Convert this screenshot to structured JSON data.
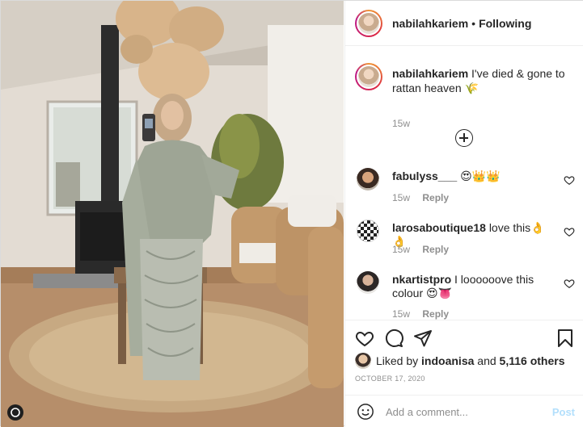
{
  "header": {
    "username": "nabilahkariem",
    "separator": "•",
    "follow_status": "Following"
  },
  "caption": {
    "username": "nabilahkariem",
    "text": "I've died & gone to rattan heaven 🌾",
    "time": "15w"
  },
  "load_more": {
    "icon": "plus-circle-icon"
  },
  "comments": [
    {
      "username": "fabulyss___",
      "text": "😍👑👑",
      "time": "15w",
      "reply": "Reply"
    },
    {
      "username": "larosaboutique18",
      "text": "love this👌👌",
      "time": "15w",
      "reply": "Reply"
    },
    {
      "username": "nkartistpro",
      "text": "I loooooove this colour 😍👅",
      "time": "15w",
      "reply": "Reply"
    }
  ],
  "actions": {
    "like_icon": "heart-icon",
    "comment_icon": "comment-icon",
    "share_icon": "paper-plane-icon",
    "save_icon": "bookmark-icon"
  },
  "likes": {
    "prefix": "Liked by ",
    "user": "indoanisa",
    "connector": " and ",
    "others": "5,116 others"
  },
  "date": "OCTOBER 17, 2020",
  "add_comment": {
    "placeholder": "Add a comment...",
    "post_label": "Post",
    "emoji_icon": "smiley-icon"
  },
  "colors": {
    "text": "#262626",
    "secondary": "#8e8e8e",
    "border": "#efefef",
    "post_disabled": "#b2dffc"
  }
}
